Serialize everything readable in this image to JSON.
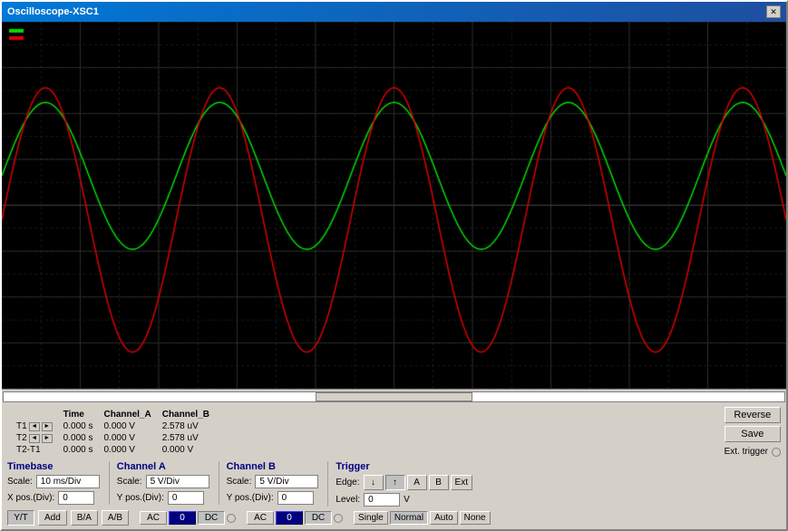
{
  "window": {
    "title": "Oscilloscope-XSC1",
    "close_btn": "✕"
  },
  "cursor_info": {
    "headers": [
      "",
      "Time",
      "Channel_A",
      "Channel_B"
    ],
    "rows": [
      {
        "label": "T1",
        "time": "0.000 s",
        "ch_a": "0.000 V",
        "ch_b": "2.578 uV"
      },
      {
        "label": "T2",
        "time": "0.000 s",
        "ch_a": "0.000 V",
        "ch_b": "2.578 uV"
      },
      {
        "label": "T2-T1",
        "time": "0.000 s",
        "ch_a": "0.000 V",
        "ch_b": "0.000 V"
      }
    ]
  },
  "right_buttons": {
    "reverse": "Reverse",
    "save": "Save",
    "ext_trigger": "Ext. trigger"
  },
  "timebase": {
    "title": "Timebase",
    "scale_label": "Scale:",
    "scale_value": "10 ms/Div",
    "xpos_label": "X pos.(Div):",
    "xpos_value": "0"
  },
  "channel_a": {
    "title": "Channel A",
    "scale_label": "Scale:",
    "scale_value": "5  V/Div",
    "ypos_label": "Y pos.(Div):",
    "ypos_value": "0",
    "ac_btn": "AC",
    "zero_btn": "0",
    "dc_btn": "DC"
  },
  "channel_b": {
    "title": "Channel B",
    "scale_label": "Scale:",
    "scale_value": "5  V/Div",
    "ypos_label": "Y pos.(Div):",
    "ypos_value": "0",
    "ac_btn": "AC",
    "zero_btn": "0",
    "dc_btn": "DC"
  },
  "trigger": {
    "title": "Trigger",
    "edge_label": "Edge:",
    "edge_fall": "↓",
    "edge_rise": "↑",
    "ch_a": "A",
    "ch_b": "B",
    "ext": "Ext",
    "level_label": "Level:",
    "level_value": "0",
    "level_unit": "V"
  },
  "bottom_buttons": {
    "yt": "Y/T",
    "add": "Add",
    "ba": "B/A",
    "ab": "A/B",
    "single": "Single",
    "normal": "Normal",
    "auto": "Auto",
    "none": "None"
  },
  "waveform": {
    "green_color": "#00cc00",
    "red_color": "#cc0000",
    "grid_color": "#404040",
    "bg_color": "#000000"
  }
}
